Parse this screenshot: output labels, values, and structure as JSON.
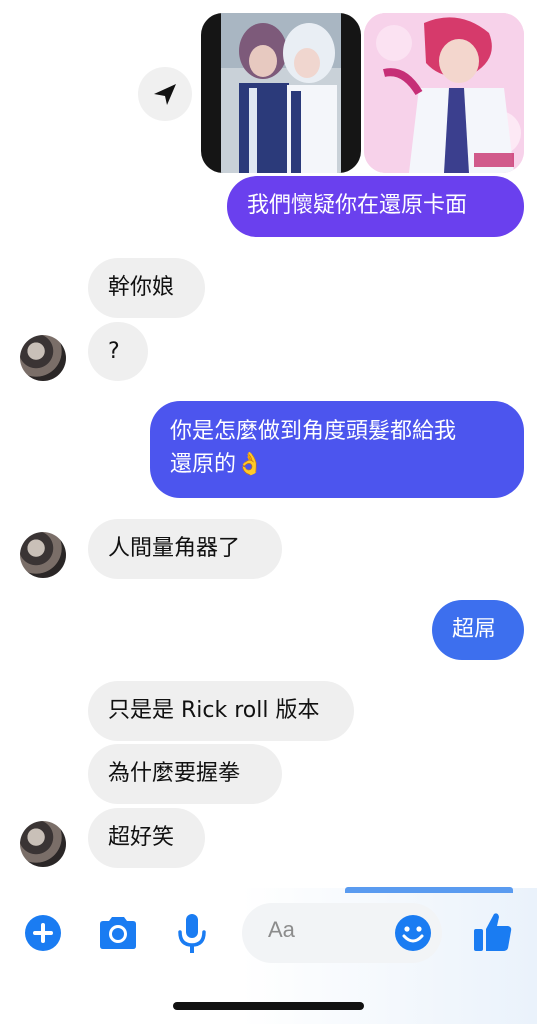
{
  "messages": [
    {
      "id": "m1",
      "from": "me",
      "text": "我們懷疑你在還原卡面"
    },
    {
      "id": "m2",
      "from": "them",
      "text": "幹你娘"
    },
    {
      "id": "m3",
      "from": "them",
      "text": "?"
    },
    {
      "id": "m4",
      "from": "me",
      "line1": "你是怎麼做到角度頭髮都給我",
      "line2": "還原的",
      "emoji": "👌"
    },
    {
      "id": "m5",
      "from": "them",
      "text": "人間量角器了"
    },
    {
      "id": "m6",
      "from": "me",
      "text": "超屌"
    },
    {
      "id": "m7",
      "from": "them",
      "text": "只是是 Rick roll 版本"
    },
    {
      "id": "m8",
      "from": "them",
      "text": "為什麼要握拳"
    },
    {
      "id": "m9",
      "from": "them",
      "text": "超好笑"
    }
  ],
  "composer": {
    "placeholder": "Aa",
    "icons": [
      "plus-icon",
      "camera-icon",
      "microphone-icon",
      "emoji-icon",
      "thumbs-up-icon"
    ]
  },
  "colors": {
    "bubble_purple": "#6a40ee",
    "bubble_indigo": "#4c55ee",
    "bubble_blue": "#3d6fee",
    "incoming": "#efefef",
    "accent": "#1a7cf2"
  },
  "icons": {
    "share": "share-arrow-icon"
  }
}
